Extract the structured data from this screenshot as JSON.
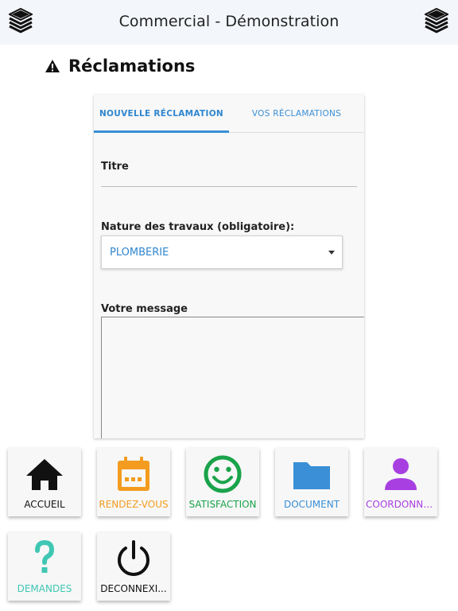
{
  "header": {
    "title": "Commercial - Démonstration"
  },
  "page": {
    "title": "Réclamations"
  },
  "tabs": [
    {
      "label": "NOUVELLE RÉCLAMATION",
      "active": true
    },
    {
      "label": "VOS RÉCLAMATIONS",
      "active": false
    }
  ],
  "form": {
    "titre_label": "Titre",
    "titre_value": "",
    "nature_label": "Nature des travaux (obligatoire):",
    "nature_value": "PLOMBERIE",
    "message_label": "Votre message",
    "message_value": ""
  },
  "menu": [
    {
      "label": "ACCUEIL",
      "icon": "home-icon",
      "color": "#111111"
    },
    {
      "label": "RENDEZ-VOUS",
      "icon": "calendar-icon",
      "color": "#f39c1f"
    },
    {
      "label": "SATISFACTION",
      "icon": "smiley-icon",
      "color": "#1aa34a"
    },
    {
      "label": "DOCUMENT",
      "icon": "folder-icon",
      "color": "#3a8fd6"
    },
    {
      "label": "COORDONNE...",
      "icon": "person-icon",
      "color": "#a83fe0"
    },
    {
      "label": "DEMANDES",
      "icon": "question-icon",
      "color": "#3fc7b4"
    },
    {
      "label": "DECONNEXI...",
      "icon": "power-icon",
      "color": "#111111"
    }
  ],
  "colors": {
    "accent": "#3a8fd6",
    "header_bg": "#f3f6fa"
  }
}
